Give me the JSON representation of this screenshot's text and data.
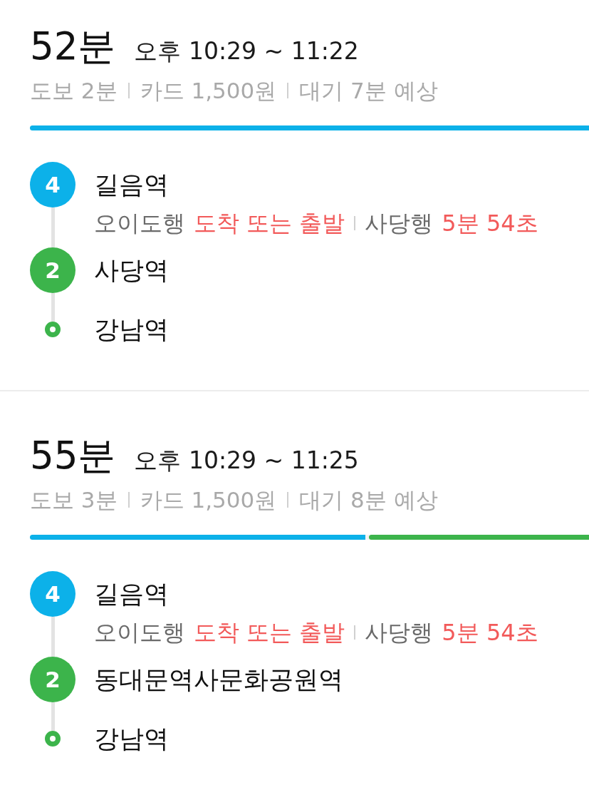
{
  "routes": [
    {
      "duration": "52분",
      "time_range": "오후 10:29 ~ 11:22",
      "summary": [
        "도보 2분",
        "카드 1,500원",
        "대기 7분 예상"
      ],
      "segments": [
        {
          "color": "#0cb1e9",
          "level": 1
        }
      ],
      "stops": [
        {
          "kind": "line",
          "line": "4",
          "color": "#0cb1e9",
          "name": "길음역",
          "arrivals": [
            {
              "direction": "오이도행",
              "status": "도착 또는 출발"
            },
            {
              "direction": "사당행",
              "status": "5분 54초"
            }
          ]
        },
        {
          "kind": "line",
          "line": "2",
          "color": "#3cb44b",
          "name": "사당역"
        },
        {
          "kind": "end",
          "color": "#3cb44b",
          "name": "강남역"
        }
      ]
    },
    {
      "duration": "55분",
      "time_range": "오후 10:29 ~ 11:25",
      "summary": [
        "도보 3분",
        "카드 1,500원",
        "대기 8분 예상"
      ],
      "segments": [
        {
          "color": "#0cb1e9",
          "level": 0.6
        },
        {
          "color": "#3cb44b",
          "level": 0.4
        }
      ],
      "stops": [
        {
          "kind": "line",
          "line": "4",
          "color": "#0cb1e9",
          "name": "길음역",
          "arrivals": [
            {
              "direction": "오이도행",
              "status": "도착 또는 출발"
            },
            {
              "direction": "사당행",
              "status": "5분 54초"
            }
          ]
        },
        {
          "kind": "line",
          "line": "2",
          "color": "#3cb44b",
          "name": "동대문역사문화공원역"
        },
        {
          "kind": "end",
          "color": "#3cb44b",
          "name": "강남역"
        }
      ]
    }
  ]
}
